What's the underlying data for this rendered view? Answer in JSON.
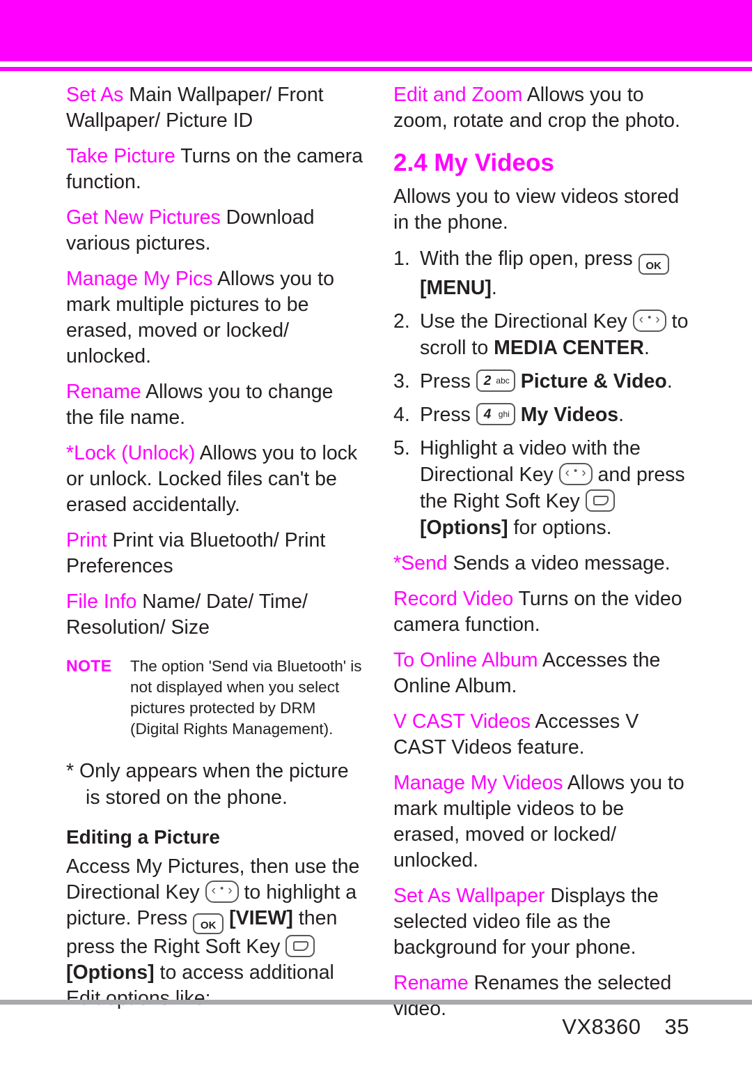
{
  "colors": {
    "accent": "#ff00ff",
    "text": "#231f20",
    "rule": "#a7a9ac"
  },
  "left_column": {
    "entries": [
      {
        "term": "Set As",
        "desc": " Main Wallpaper/ Front Wallpaper/ Picture ID"
      },
      {
        "term": "Take Picture",
        "desc": " Turns on the camera function."
      },
      {
        "term": "Get New Pictures",
        "desc": " Download various pictures."
      },
      {
        "term": "Manage My Pics",
        "desc": " Allows you to mark multiple pictures to be erased, moved or locked/ unlocked."
      },
      {
        "term": "Rename",
        "desc": " Allows you to change the file name."
      },
      {
        "term": "*Lock (Unlock)",
        "desc": " Allows you to lock or unlock. Locked files can't be erased accidentally."
      },
      {
        "term": "Print",
        "desc": " Print via Bluetooth/ Print Preferences"
      },
      {
        "term": "File Info",
        "desc": " Name/ Date/ Time/ Resolution/ Size"
      }
    ],
    "note": {
      "label": "NOTE",
      "text": "The option 'Send via Bluetooth' is not displayed when you select pictures protected by DRM (Digital Rights Management)."
    },
    "star_note": "* Only appears when the picture is stored on the phone.",
    "subheading": "Editing a Picture",
    "editing_paragraph": {
      "part1": "Access My Pictures, then use the Directional Key ",
      "part2": " to highlight a picture. Press ",
      "part3": " ",
      "view_label": "[VIEW]",
      "part4": " then press the Right Soft Key ",
      "part5": " ",
      "options_label": "[Options]",
      "part6": " to access additional Edit options like:"
    }
  },
  "right_column": {
    "top_entry": {
      "term": "Edit and Zoom",
      "desc": " Allows you to zoom, rotate and crop the photo."
    },
    "section_title": "2.4 My Videos",
    "intro": "Allows you to view videos stored in the phone.",
    "steps": [
      {
        "num": "1.",
        "text_before": "With the flip open, press ",
        "key": "OK",
        "text_after": "",
        "bold_tail": "[MENU]",
        "tail_punct": "."
      },
      {
        "num": "2.",
        "text_before": "Use the Directional Key ",
        "key": "directional",
        "text_after": " to scroll to ",
        "bold_tail": "MEDIA CENTER",
        "tail_punct": "."
      },
      {
        "num": "3.",
        "text_before": "Press ",
        "key": "2abc",
        "text_after": " ",
        "bold_tail": "Picture & Video",
        "tail_punct": "."
      },
      {
        "num": "4.",
        "text_before": "Press ",
        "key": "4ghi",
        "text_after": " ",
        "bold_tail": "My Videos",
        "tail_punct": "."
      },
      {
        "num": "5.",
        "text_before": "Highlight a video with the Directional Key ",
        "key": "directional",
        "text_after": " and press the Right Soft Key ",
        "key2": "soft",
        "bold_tail": "[Options]",
        "tail_punct": " for options."
      }
    ],
    "entries": [
      {
        "term": "*Send",
        "desc": " Sends a video message."
      },
      {
        "term": "Record Video",
        "desc": " Turns on the video camera function."
      },
      {
        "term": "To Online Album",
        "desc": " Accesses the Online Album."
      },
      {
        "term": "V CAST Videos",
        "desc": " Accesses V CAST Videos feature."
      },
      {
        "term": "Manage My Videos",
        "desc": " Allows you to mark multiple videos to be erased, moved or locked/ unlocked."
      },
      {
        "term": "Set As Wallpaper",
        "desc": " Displays the selected video file as the background for your phone."
      },
      {
        "term": "Rename",
        "desc": " Renames the selected video."
      }
    ]
  },
  "footer": {
    "model": "VX8360",
    "page": "35"
  },
  "keys": {
    "ok_label": "OK",
    "two_digit": "2",
    "two_sub": "abc",
    "four_digit": "4",
    "four_sub": "ghi"
  }
}
